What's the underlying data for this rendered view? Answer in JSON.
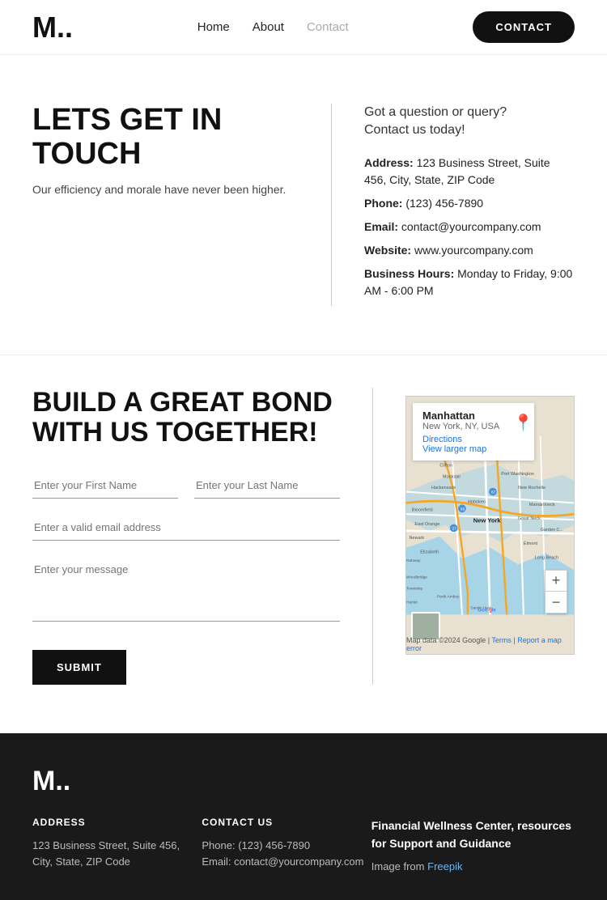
{
  "header": {
    "logo": "M.",
    "nav": [
      {
        "label": "Home",
        "active": false
      },
      {
        "label": "About",
        "active": false
      },
      {
        "label": "Contact",
        "active": true
      }
    ],
    "cta_label": "CONTACT"
  },
  "touch_section": {
    "heading": "LETS GET IN TOUCH",
    "subheading": "Our efficiency and morale have never been higher.",
    "tagline_line1": "Got a question or query?",
    "tagline_line2": "Contact us today!",
    "address_label": "Address:",
    "address_value": "123 Business Street, Suite 456, City, State, ZIP Code",
    "phone_label": "Phone:",
    "phone_value": "(123) 456-7890",
    "email_label": "Email:",
    "email_value": "contact@yourcompany.com",
    "website_label": "Website:",
    "website_value": "www.yourcompany.com",
    "hours_label": "Business Hours:",
    "hours_value": "Monday to Friday, 9:00 AM - 6:00 PM"
  },
  "bond_section": {
    "heading_line1": "BUILD A GREAT BOND",
    "heading_line2": "WITH US TOGETHER!",
    "form": {
      "first_name_placeholder": "Enter your First Name",
      "last_name_placeholder": "Enter your Last Name",
      "email_placeholder": "Enter a valid email address",
      "message_placeholder": "Enter your message",
      "submit_label": "SUBMIT"
    }
  },
  "map": {
    "place_name": "Manhattan",
    "place_location": "New York, NY, USA",
    "directions_label": "Directions",
    "larger_label": "View larger map",
    "zoom_plus": "+",
    "zoom_minus": "−",
    "attribution": "Map data ©2024 Google",
    "terms": "Terms",
    "report": "Report a map error"
  },
  "footer": {
    "logo": "M.",
    "address_heading": "ADDRESS",
    "address_value": "123 Business Street, Suite 456, City, State, ZIP Code",
    "contact_heading": "CONTACT US",
    "phone_value": "Phone: (123) 456-7890",
    "email_value": "Email: contact@yourcompany.com",
    "wellness_heading": "Financial Wellness Center, resources for Support and Guidance",
    "image_from_label": "Image from",
    "freepik_label": "Freepik"
  }
}
